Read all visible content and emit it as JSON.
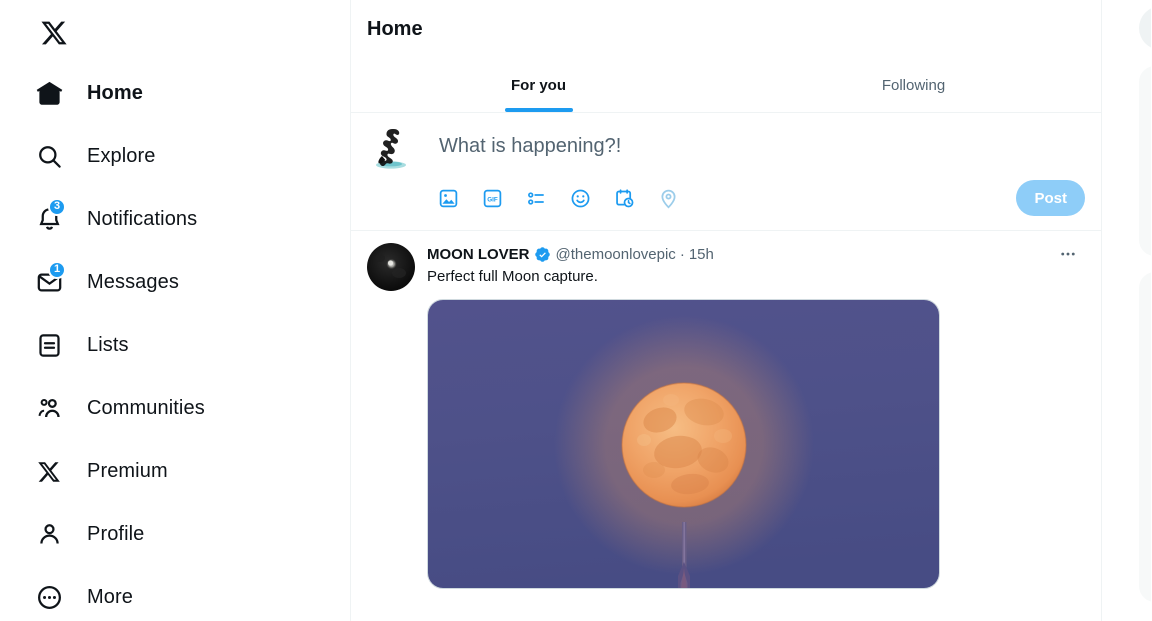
{
  "app": {
    "brand": "X",
    "logo_icon": "x-logo-icon"
  },
  "sidebar": {
    "items": [
      {
        "label": "Home",
        "icon": "home-icon",
        "active": true,
        "badge": null
      },
      {
        "label": "Explore",
        "icon": "search-icon",
        "active": false,
        "badge": null
      },
      {
        "label": "Notifications",
        "icon": "bell-icon",
        "active": false,
        "badge": "3"
      },
      {
        "label": "Messages",
        "icon": "envelope-icon",
        "active": false,
        "badge": "1"
      },
      {
        "label": "Lists",
        "icon": "list-icon",
        "active": false,
        "badge": null
      },
      {
        "label": "Communities",
        "icon": "people-icon",
        "active": false,
        "badge": null
      },
      {
        "label": "Premium",
        "icon": "x-logo-icon",
        "active": false,
        "badge": null
      },
      {
        "label": "Profile",
        "icon": "person-icon",
        "active": false,
        "badge": null
      },
      {
        "label": "More",
        "icon": "more-circle-icon",
        "active": false,
        "badge": null
      }
    ]
  },
  "header": {
    "title": "Home"
  },
  "tabs": [
    {
      "label": "For you",
      "active": true
    },
    {
      "label": "Following",
      "active": false
    }
  ],
  "composer": {
    "placeholder": "What is happening?!",
    "avatar_alt": "dancer-silhouette-avatar",
    "post_label": "Post",
    "post_disabled": true,
    "icons": [
      {
        "name": "media-image-icon",
        "enabled": true
      },
      {
        "name": "gif-icon",
        "enabled": true,
        "text": "GIF"
      },
      {
        "name": "poll-icon",
        "enabled": true
      },
      {
        "name": "emoji-icon",
        "enabled": true
      },
      {
        "name": "schedule-icon",
        "enabled": true
      },
      {
        "name": "location-pin-icon",
        "enabled": false
      }
    ]
  },
  "timeline": {
    "posts": [
      {
        "display_name": "MOON LOVER",
        "verified": true,
        "handle": "@themoonlovepic",
        "separator": "·",
        "timestamp": "15h",
        "text": "Perfect full Moon capture.",
        "avatar_alt": "moon-photo-avatar",
        "media_alt": "full-moon-over-tower-photo",
        "more_label": "More"
      }
    ]
  },
  "colors": {
    "accent": "#1d9bf0",
    "post_button": "#8ecdf8",
    "text_primary": "#0f1419",
    "text_secondary": "#536471",
    "border": "#eff3f4",
    "sky": "#4f5188",
    "moon": "#f0a060"
  }
}
